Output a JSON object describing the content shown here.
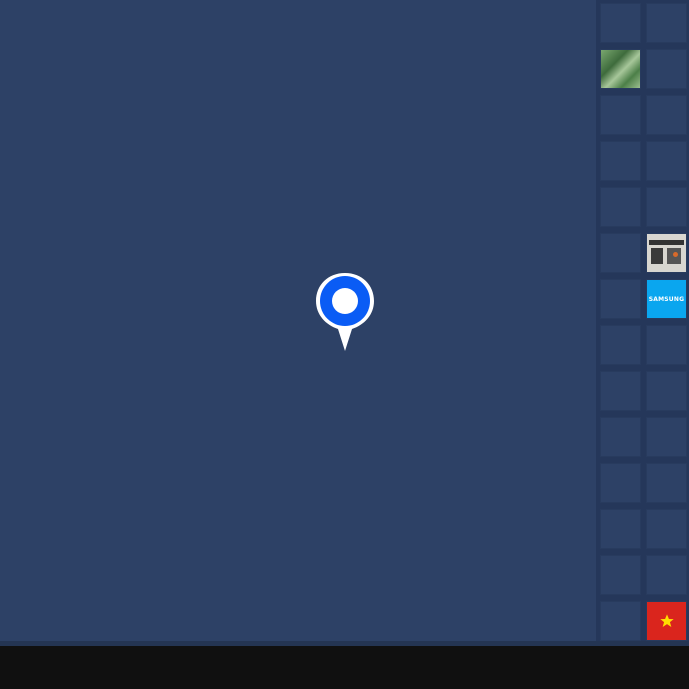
{
  "map": {
    "background_color": "#2d4166",
    "marker": {
      "icon": "location-pin-icon",
      "color": "#0a5cf5"
    }
  },
  "side_panel": {
    "tiles": [
      {
        "kind": "empty"
      },
      {
        "kind": "empty"
      },
      {
        "kind": "leaf",
        "icon": "leaf-photo-icon"
      },
      {
        "kind": "empty"
      },
      {
        "kind": "empty"
      },
      {
        "kind": "empty"
      },
      {
        "kind": "empty"
      },
      {
        "kind": "empty"
      },
      {
        "kind": "empty"
      },
      {
        "kind": "empty"
      },
      {
        "kind": "empty"
      },
      {
        "kind": "shop",
        "icon": "shop-photo-icon"
      },
      {
        "kind": "empty"
      },
      {
        "kind": "brand",
        "label": "SAMSUNG",
        "color": "#0aa6ef"
      },
      {
        "kind": "empty"
      },
      {
        "kind": "empty"
      },
      {
        "kind": "empty"
      },
      {
        "kind": "empty"
      },
      {
        "kind": "empty"
      },
      {
        "kind": "empty"
      },
      {
        "kind": "empty"
      },
      {
        "kind": "empty"
      },
      {
        "kind": "empty"
      },
      {
        "kind": "empty"
      },
      {
        "kind": "empty"
      },
      {
        "kind": "empty"
      },
      {
        "kind": "empty"
      },
      {
        "kind": "flag",
        "icon": "vietnam-flag-icon",
        "color": "#da251d"
      }
    ]
  }
}
